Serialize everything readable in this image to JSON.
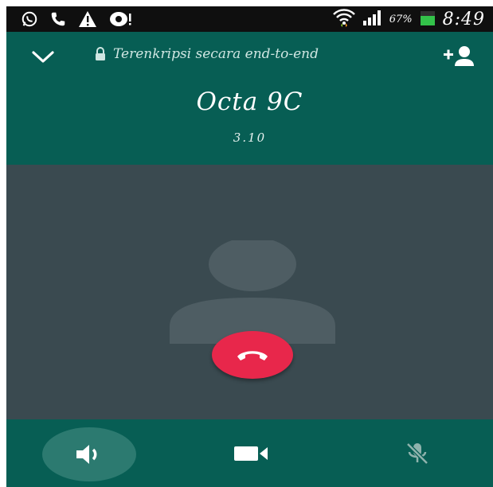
{
  "status_bar": {
    "battery_percent": "67%",
    "time": "8:49",
    "left_icons": [
      "whatsapp-icon",
      "phone-icon",
      "warning-icon",
      "camera-notification-icon"
    ],
    "right_icons": [
      "wifi-icon",
      "signal-icon",
      "battery-icon"
    ]
  },
  "call": {
    "encryption_text": "Terenkripsi secara end-to-end",
    "contact_name": "Octa 9C",
    "duration": "3.10"
  },
  "controls": {
    "speaker_active": true,
    "buttons": [
      "speaker-icon",
      "video-icon",
      "mute-mic-icon"
    ]
  },
  "colors": {
    "header_green": "#075e54",
    "body_grey": "#3a4a50",
    "end_call_red": "#e8274b",
    "speaker_active_bg": "#2c7a70"
  }
}
